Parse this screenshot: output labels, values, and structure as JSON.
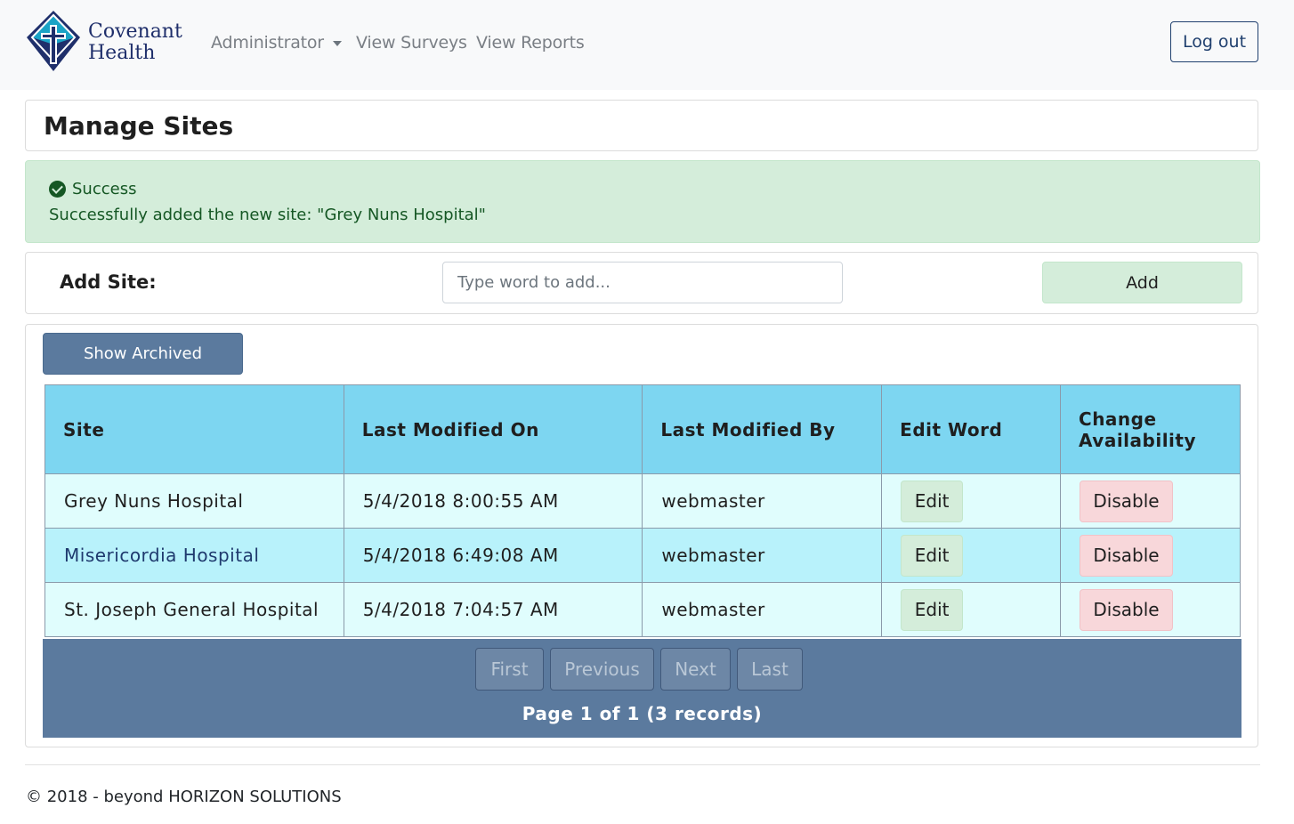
{
  "nav": {
    "logo_line1": "Covenant",
    "logo_line2": "Health",
    "administrator": "Administrator",
    "view_surveys": "View Surveys",
    "view_reports": "View Reports",
    "logout": "Log out"
  },
  "page": {
    "title": "Manage Sites"
  },
  "alert": {
    "title": "Success",
    "message": "Successfully added the new site: \"Grey Nuns Hospital\""
  },
  "add_site": {
    "label": "Add Site:",
    "placeholder": "Type word to add...",
    "value": "",
    "button": "Add"
  },
  "show_archived": "Show Archived",
  "table": {
    "headers": [
      "Site",
      "Last Modified On",
      "Last Modified By",
      "Edit Word",
      "Change Availability"
    ],
    "rows": [
      {
        "site": "Grey Nuns Hospital",
        "modified_on": "5/4/2018 8:00:55 AM",
        "modified_by": "webmaster",
        "edit": "Edit",
        "disable": "Disable"
      },
      {
        "site": "Misericordia Hospital",
        "modified_on": "5/4/2018 6:49:08 AM",
        "modified_by": "webmaster",
        "edit": "Edit",
        "disable": "Disable"
      },
      {
        "site": "St. Joseph General Hospital",
        "modified_on": "5/4/2018 7:04:57 AM",
        "modified_by": "webmaster",
        "edit": "Edit",
        "disable": "Disable"
      }
    ]
  },
  "pager": {
    "first": "First",
    "previous": "Previous",
    "next": "Next",
    "last": "Last",
    "info": "Page 1 of 1 (3 records)"
  },
  "footer": {
    "text": "© 2018 - beyond HORIZON SOLUTIONS"
  },
  "colors": {
    "navbar_bg": "#f8f9fa",
    "brand_navy": "#1f2f6b",
    "brand_teal": "#1aa3c6",
    "success_bg": "#d4edda",
    "danger_bg": "#f8d7da",
    "table_header_bg": "#7dd6f1",
    "pager_bg": "#5b7a9e"
  }
}
